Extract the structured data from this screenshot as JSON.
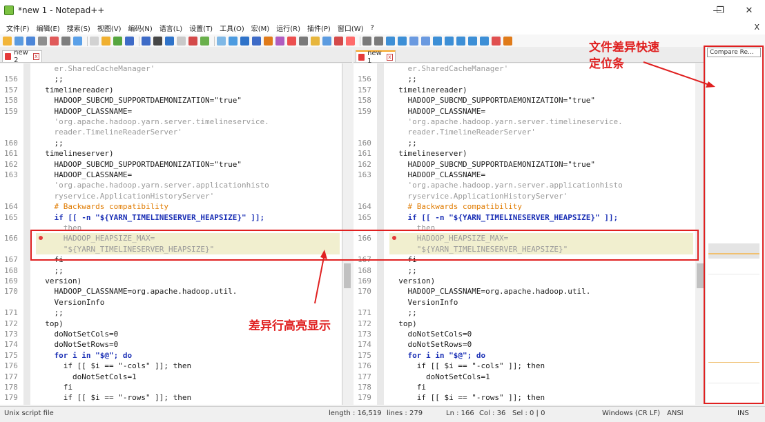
{
  "window": {
    "title": "*new 1 - Notepad++",
    "minimize": "—",
    "maximize": "❐",
    "close": "✕"
  },
  "menu": {
    "items": [
      "文件(F)",
      "编辑(E)",
      "搜索(S)",
      "视图(V)",
      "编码(N)",
      "语言(L)",
      "设置(T)",
      "工具(O)",
      "宏(M)",
      "运行(R)",
      "插件(P)",
      "窗口(W)",
      "?"
    ],
    "close": "X"
  },
  "toolbar": {
    "colors": [
      "#f2b53a",
      "#5b9be0",
      "#4c86d8",
      "#8e8e8e",
      "#e05a5a",
      "#7e7e7e",
      "#5aa0e8",
      "#d2d2d2",
      "#f0b030",
      "#56a63f",
      "#3e6bc7",
      "#3e6bc7",
      "#474747",
      "#2f73c9",
      "#c9c9c9",
      "#d44a4a",
      "#6ab04c",
      "#7fb8e6",
      "#4c9be0",
      "#2f73c9",
      "#3e6bc7",
      "#e07b1a",
      "#b05cc0",
      "#ec4f4f",
      "#7a7a7a",
      "#e7b63d",
      "#5b9be0",
      "#d44a4a",
      "#ff6b6b",
      "#7a7a7a",
      "#7a7a7a",
      "#3d8fd6",
      "#3d8fd6",
      "#6b9ae0",
      "#6b9ae0",
      "#3d8fd6",
      "#3d8fd6",
      "#3d8fd6",
      "#3d8fd6",
      "#3d8fd6",
      "#e05050",
      "#e07b1a"
    ]
  },
  "tabs": {
    "left": {
      "name": "new 2",
      "close": "x"
    },
    "right": {
      "name": "new 1",
      "close": "x"
    }
  },
  "editor": {
    "rows": [
      {
        "ln": "",
        "text": "    er.SharedCacheManager'",
        "color": "gray"
      },
      {
        "ln": "156",
        "text": "    ;;",
        "color": "dark"
      },
      {
        "ln": "157",
        "text": "  timelinereader)",
        "color": "dark"
      },
      {
        "ln": "158",
        "text": "    HADOOP_SUBCMD_SUPPORTDAEMONIZATION=\"true\"",
        "color": "dark"
      },
      {
        "ln": "159",
        "text": "    HADOOP_CLASSNAME=",
        "color": "dark"
      },
      {
        "ln": "",
        "text": "    'org.apache.hadoop.yarn.server.timelineservice.",
        "color": "gray"
      },
      {
        "ln": "",
        "text": "    reader.TimelineReaderServer'",
        "color": "gray"
      },
      {
        "ln": "160",
        "text": "    ;;",
        "color": "dark"
      },
      {
        "ln": "161",
        "text": "  timelineserver)",
        "color": "dark"
      },
      {
        "ln": "162",
        "text": "    HADOOP_SUBCMD_SUPPORTDAEMONIZATION=\"true\"",
        "color": "dark"
      },
      {
        "ln": "163",
        "text": "    HADOOP_CLASSNAME=",
        "color": "dark"
      },
      {
        "ln": "",
        "text": "    'org.apache.hadoop.yarn.server.applicationhisto",
        "color": "gray"
      },
      {
        "ln": "",
        "text": "    ryservice.ApplicationHistoryServer'",
        "color": "gray"
      },
      {
        "ln": "164",
        "text": "    # Backwards compatibility",
        "color": "orange"
      },
      {
        "ln": "165",
        "text": "    if [[ -n \"${YARN_TIMELINESERVER_HEAPSIZE}\" ]];",
        "color": "blue"
      },
      {
        "ln": "",
        "text": "      then",
        "color": "gray"
      },
      {
        "ln": "166",
        "text": "      HADOOP_HEAPSIZE_MAX=",
        "color": "gray"
      },
      {
        "ln": "",
        "text": "      \"${YARN_TIMELINESERVER_HEAPSIZE}\"",
        "color": "gray"
      },
      {
        "ln": "167",
        "text": "    fi",
        "color": "dark"
      },
      {
        "ln": "168",
        "text": "    ;;",
        "color": "dark"
      },
      {
        "ln": "169",
        "text": "  version)",
        "color": "dark"
      },
      {
        "ln": "170",
        "text": "    HADOOP_CLASSNAME=org.apache.hadoop.util.",
        "color": "dark"
      },
      {
        "ln": "",
        "text": "    VersionInfo",
        "color": "dark"
      },
      {
        "ln": "171",
        "text": "    ;;",
        "color": "dark"
      },
      {
        "ln": "172",
        "text": "  top)",
        "color": "dark"
      },
      {
        "ln": "173",
        "text": "    doNotSetCols=0",
        "color": "dark"
      },
      {
        "ln": "174",
        "text": "    doNotSetRows=0",
        "color": "dark"
      },
      {
        "ln": "175",
        "text": "    for i in \"$@\"; do",
        "color": "blue"
      },
      {
        "ln": "176",
        "text": "      if [[ $i == \"-cols\" ]]; then",
        "color": "dark"
      },
      {
        "ln": "177",
        "text": "        doNotSetCols=1",
        "color": "dark"
      },
      {
        "ln": "178",
        "text": "      fi",
        "color": "dark"
      },
      {
        "ln": "179",
        "text": "      if [[ $i == \"-rows\" ]]; then",
        "color": "dark"
      }
    ]
  },
  "annotations": {
    "diff_highlight": "差异行高亮显示",
    "docmap_line1": "文件差异快速",
    "docmap_line2": "定位条"
  },
  "docmap": {
    "title": "Compare Re..."
  },
  "status": {
    "filetype": "Unix script file",
    "length": "length : 16,519",
    "lines": "lines : 279",
    "ln": "Ln : 166",
    "col": "Col : 36",
    "sel": "Sel : 0 | 0",
    "eol": "Windows (CR LF)",
    "encoding": "ANSI",
    "mode": "INS"
  }
}
